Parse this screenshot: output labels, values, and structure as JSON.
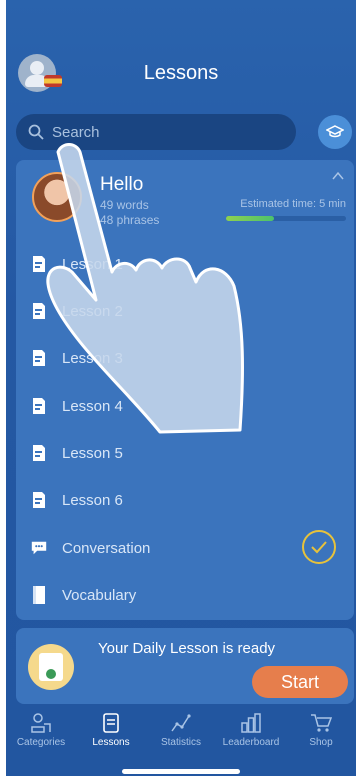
{
  "header": {
    "title": "Lessons",
    "search_placeholder": "Search"
  },
  "card": {
    "greeting": "Hello",
    "words": "49 words",
    "phrases": "48 phrases",
    "estimated_time": "Estimated time: 5 min",
    "progress_fraction": 0.4,
    "items": [
      {
        "label": "Lesson 1",
        "icon": "lesson-doc-icon"
      },
      {
        "label": "Lesson 2",
        "icon": "lesson-doc-icon"
      },
      {
        "label": "Lesson 3",
        "icon": "lesson-doc-icon"
      },
      {
        "label": "Lesson 4",
        "icon": "lesson-doc-icon"
      },
      {
        "label": "Lesson 5",
        "icon": "lesson-doc-icon"
      },
      {
        "label": "Lesson 6",
        "icon": "lesson-doc-icon"
      },
      {
        "label": "Conversation",
        "icon": "chat-icon"
      },
      {
        "label": "Vocabulary",
        "icon": "book-icon"
      }
    ]
  },
  "daily": {
    "text": "Your Daily Lesson is ready",
    "start_label": "Start"
  },
  "tabbar": {
    "items": [
      {
        "label": "Categories",
        "active": false
      },
      {
        "label": "Lessons",
        "active": true
      },
      {
        "label": "Statistics",
        "active": false
      },
      {
        "label": "Leaderboard",
        "active": false
      },
      {
        "label": "Shop",
        "active": false
      }
    ]
  },
  "colors": {
    "background": "#2458a3",
    "card": "#3b74bd",
    "accent_start": "#e67e4c",
    "check": "#e7c23b"
  }
}
